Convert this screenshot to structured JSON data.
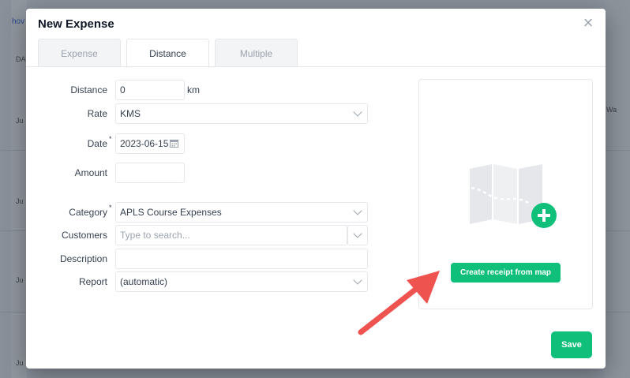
{
  "modal": {
    "title": "New Expense",
    "close_glyph": "×"
  },
  "tabs": [
    {
      "label": "Expense",
      "active": false
    },
    {
      "label": "Distance",
      "active": true
    },
    {
      "label": "Multiple",
      "active": false
    }
  ],
  "form": {
    "distance": {
      "label": "Distance",
      "value": "0",
      "unit": "km"
    },
    "rate": {
      "label": "Rate",
      "value": "KMS"
    },
    "date": {
      "label": "Date",
      "required_mark": "*",
      "value": "2023-06-15"
    },
    "amount": {
      "label": "Amount",
      "value": ""
    },
    "category": {
      "label": "Category",
      "required_mark": "*",
      "value": "APLS Course Expenses"
    },
    "customers": {
      "label": "Customers",
      "placeholder": "Type to search..."
    },
    "description": {
      "label": "Description",
      "value": ""
    },
    "report": {
      "label": "Report",
      "value": "(automatic)"
    }
  },
  "receipt": {
    "create_label": "Create receipt from map",
    "map_icon": "map-icon",
    "add_icon": "plus-circle-icon"
  },
  "save_label": "Save",
  "colors": {
    "accent": "#10c07a",
    "arrow": "#ef5350"
  },
  "background": {
    "left_fragment": "hov",
    "col_fragment": "DA",
    "right_fragment": "Wa",
    "row_fragments": [
      "Ju",
      "Ju",
      "Ju",
      "Ju"
    ]
  }
}
